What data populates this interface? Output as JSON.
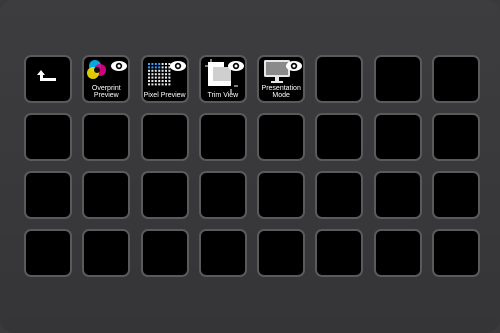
{
  "deck": {
    "keys": [
      {
        "id": "back",
        "icon": "back-arrow-icon",
        "lines": []
      },
      {
        "id": "overprint-preview",
        "icon": "color-circles-eye-icon",
        "lines": [
          "Overprint",
          "Preview"
        ]
      },
      {
        "id": "pixel-preview",
        "icon": "pixel-grid-eye-icon",
        "lines": [
          "Pixel Preview"
        ]
      },
      {
        "id": "trim-view",
        "icon": "trim-crop-eye-icon",
        "lines": [
          "Trim View"
        ]
      },
      {
        "id": "presentation-mode",
        "icon": "monitor-eye-icon",
        "lines": [
          "Presentation",
          "Mode"
        ]
      }
    ],
    "empty_key_count": 27,
    "colors": {
      "background": "#3a3a3c",
      "key_fill": "#000000",
      "key_border": "#5a5a5c",
      "label": "#ffffff"
    }
  }
}
